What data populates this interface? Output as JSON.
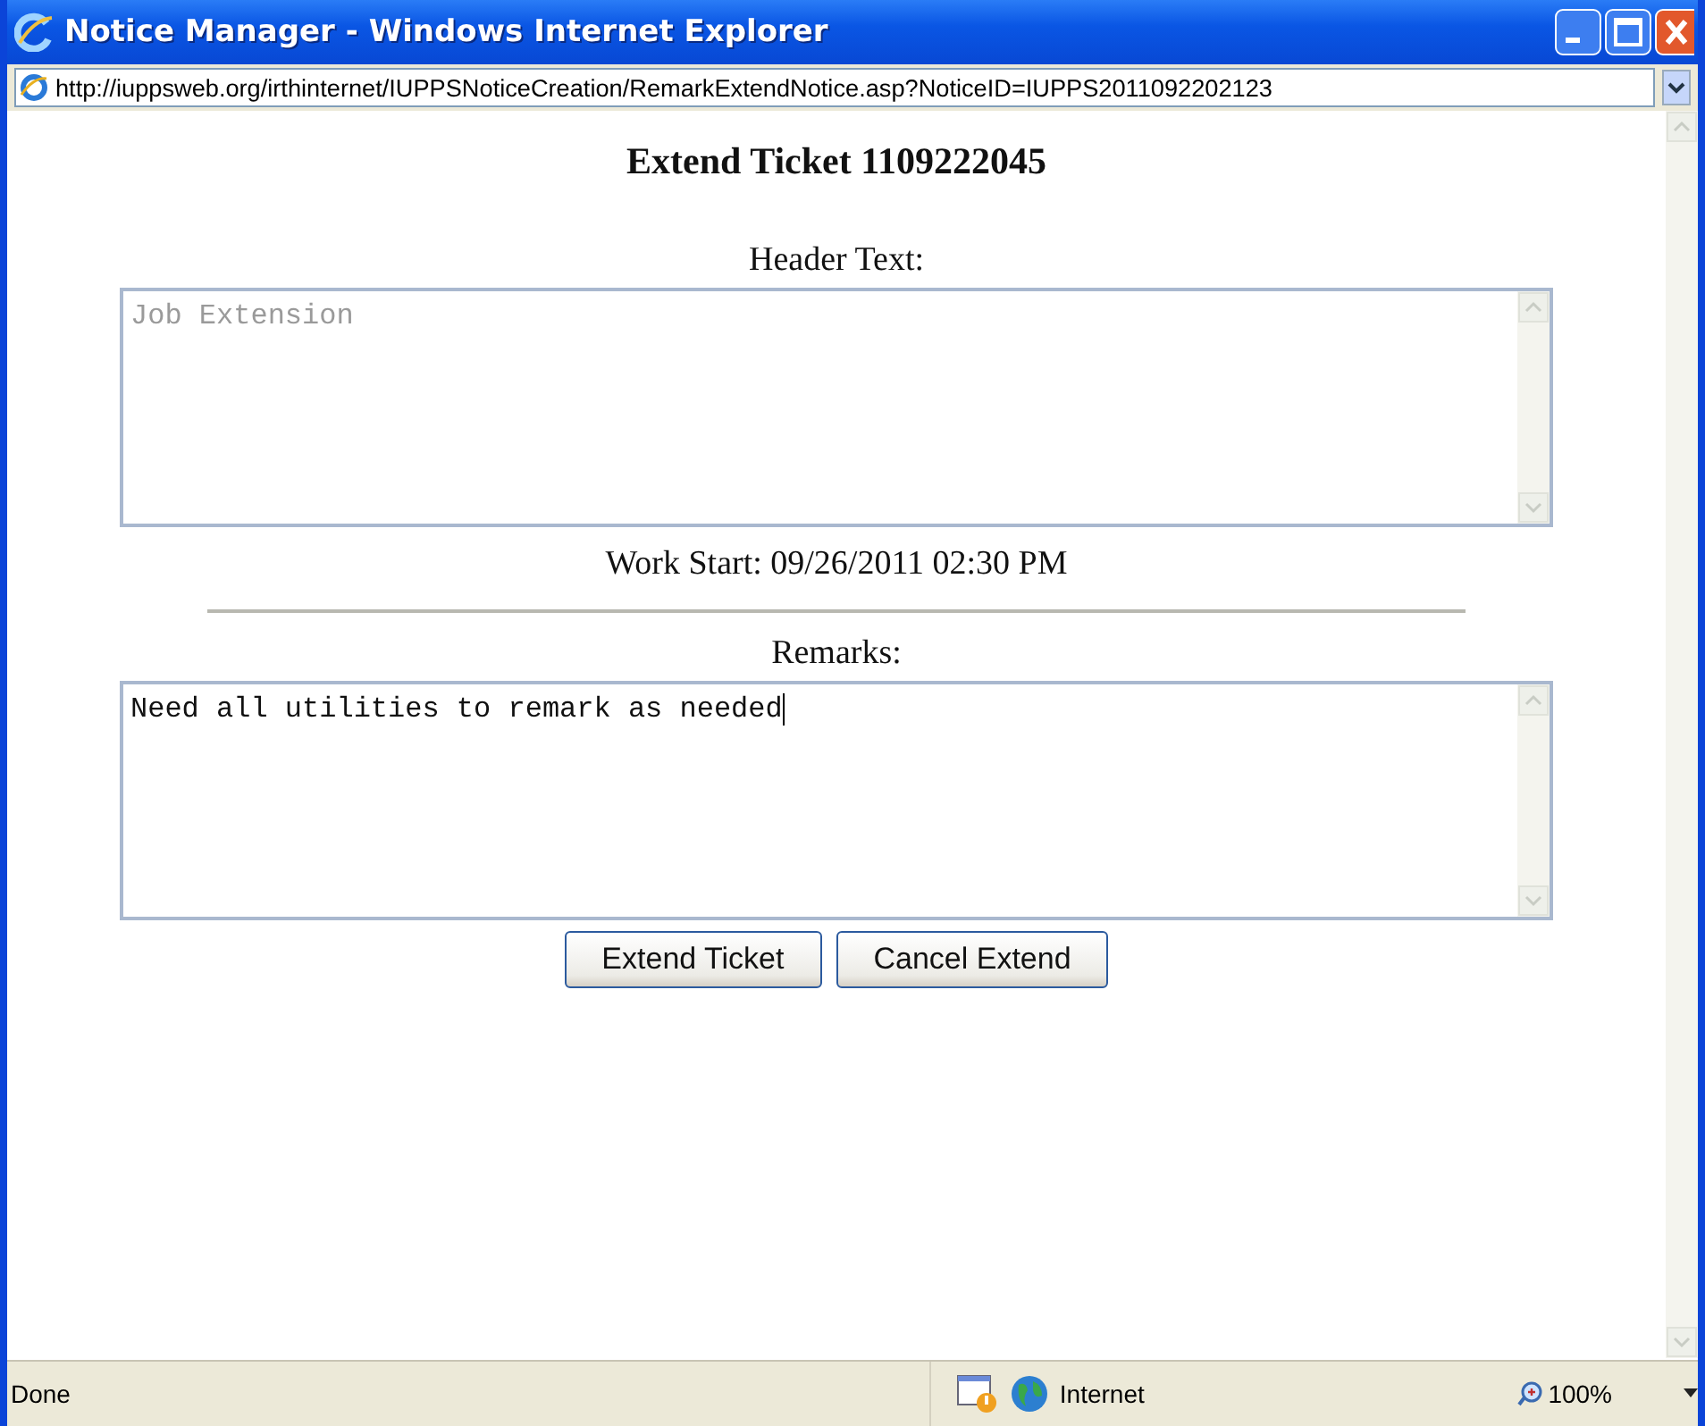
{
  "window": {
    "title": "Notice Manager - Windows Internet Explorer"
  },
  "address_bar": {
    "url": "http://iuppsweb.org/irthinternet/IUPPSNoticeCreation/RemarkExtendNotice.asp?NoticeID=IUPPS2011092202123"
  },
  "page": {
    "heading": "Extend Ticket 1109222045",
    "header_label": "Header Text:",
    "header_field": {
      "value": "Job Extension",
      "disabled": true
    },
    "work_start": "Work Start: 09/26/2011 02:30 PM",
    "remarks_label": "Remarks:",
    "remarks_field": {
      "value": "Need all utilities to remark as needed",
      "disabled": false
    },
    "buttons": [
      "Extend Ticket",
      "Cancel Extend"
    ]
  },
  "status_bar": {
    "status": "Done",
    "zone": "Internet",
    "zoom": "100%"
  }
}
